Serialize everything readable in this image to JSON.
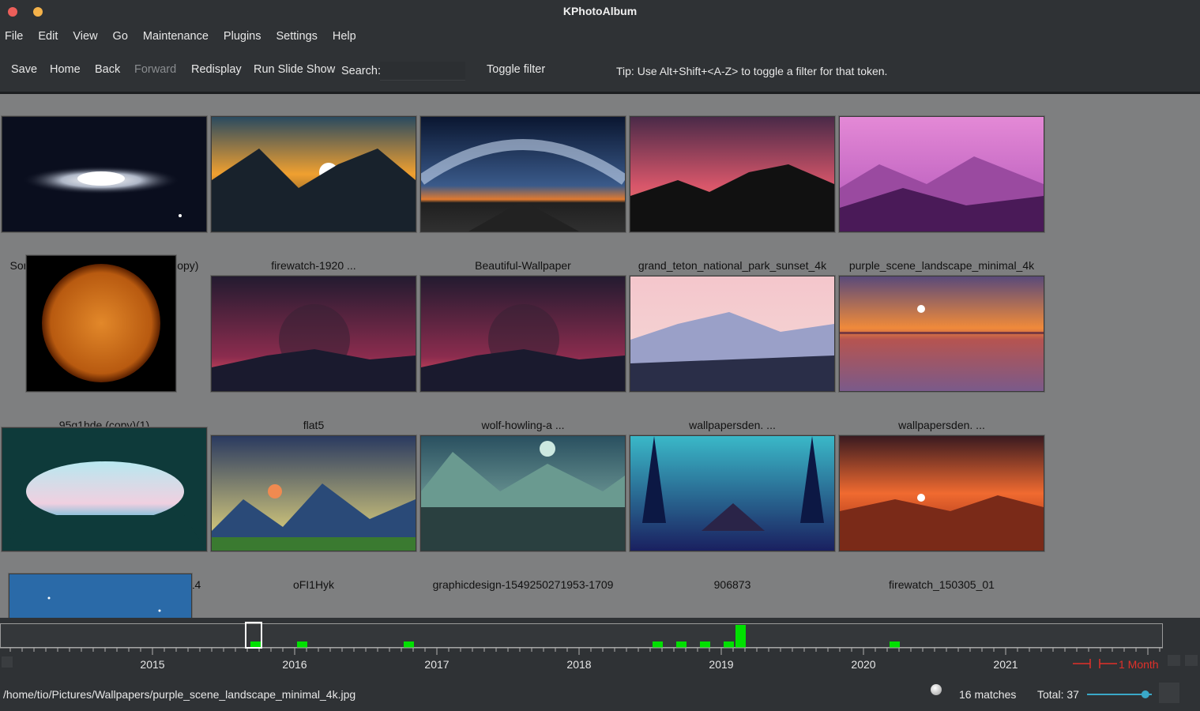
{
  "window": {
    "title": "KPhotoAlbum"
  },
  "menu": [
    "File",
    "Edit",
    "View",
    "Go",
    "Maintenance",
    "Plugins",
    "Settings",
    "Help"
  ],
  "toolbar": {
    "save": "Save",
    "home": "Home",
    "back": "Back",
    "forward": "Forward",
    "redisplay": "Redisplay",
    "slideshow": "Run Slide Show",
    "search_label": "Search:",
    "search_value": "",
    "toggle_filter": "Toggle filter",
    "tip": "Tip: Use Alt+Shift+<A-Z> to toggle a filter for that token."
  },
  "thumbnails": [
    "Sombrero-Galaxy-1-1080x1920 (copy)",
    "firewatch-1920 ...",
    "Beautiful-Wallpaper",
    "grand_teton_national_park_sunset_4k",
    "purple_scene_landscape_minimal_4k",
    "95q1hde (copy)(1)",
    "flat5",
    "wolf-howling-a ...",
    "wallpapersden. ...",
    "wallpapersden. ...",
    "2cbaa6ea08706b054b8d34fe19baa514",
    "oFI1Hyk",
    "graphicdesign-1549250271953-1709",
    "906873",
    "firewatch_150305_01"
  ],
  "timeline": {
    "years": [
      "2015",
      "2016",
      "2017",
      "2018",
      "2019",
      "2020",
      "2021"
    ],
    "zoom_label": "1 Month",
    "bar_heights": [
      0.25,
      0.25,
      0.25,
      0.25,
      0.25,
      0.25,
      0.25,
      1.0,
      0.25
    ],
    "colors": {
      "bar": "#00e000",
      "zoom": "#e0302a",
      "axis": "#b0b0b0"
    }
  },
  "status": {
    "path": "/home/tio/Pictures/Wallpapers/purple_scene_landscape_minimal_4k.jpg",
    "matches": "16 matches",
    "total": "Total: 37",
    "thumbnail_size": 0.9
  }
}
